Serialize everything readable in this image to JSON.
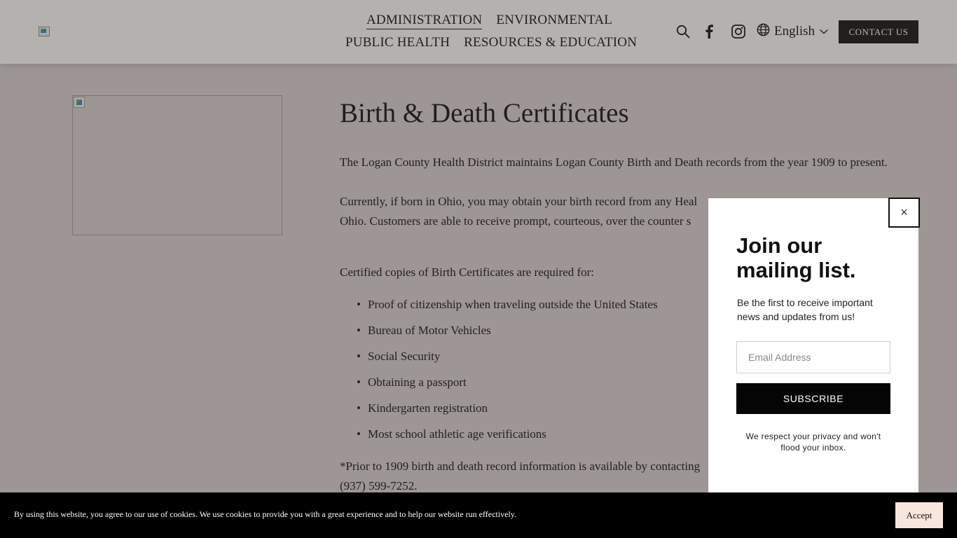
{
  "header": {
    "nav_row1": [
      "ADMINISTRATION",
      "ENVIRONMENTAL"
    ],
    "nav_row2": [
      "PUBLIC HEALTH",
      "RESOURCES & EDUCATION"
    ],
    "active_nav": "ADMINISTRATION",
    "icons": [
      "search-icon",
      "facebook-icon",
      "instagram-icon",
      "globe-icon",
      "chevron-down-icon"
    ],
    "language": "English",
    "contact_label": "CONTACT US"
  },
  "main": {
    "title": "Birth & Death Certificates",
    "p1": "The Logan County Health District maintains Logan County Birth and Death records from the year 1909 to present.",
    "p2": "Currently, if born in Ohio, you may obtain your birth record from any Heal",
    "p2b": "Ohio.  Customers are able to receive prompt, courteous, over the counter s",
    "p3": "Certified copies of Birth Certificates are required for:",
    "bullets": [
      "Proof of citizenship when traveling outside the United States",
      "Bureau of Motor Vehicles",
      "Social Security",
      "Obtaining a passport",
      "Kindergarten registration",
      "Most school athletic age verifications"
    ],
    "p4a": "*Prior to 1909 birth and death record information is available by contacting",
    "p4b": "(937) 599-7252."
  },
  "popup": {
    "close_label": "×",
    "title": "Join our mailing list.",
    "description": "Be the first to receive important news and updates from us!",
    "email_placeholder": "Email Address",
    "subscribe_label": "SUBSCRIBE",
    "privacy_text": "We respect your privacy and won't flood your inbox."
  },
  "cookie": {
    "text": "By using this website, you agree to our use of cookies. We use cookies to provide you with a great experience and to help our website run effectively.",
    "accept_label": "Accept"
  },
  "colors": {
    "header_bg": "#fdfdf9",
    "page_bg": "#d8d1cf",
    "button_dark": "#111111",
    "accept_bg": "#f8e6dc"
  }
}
